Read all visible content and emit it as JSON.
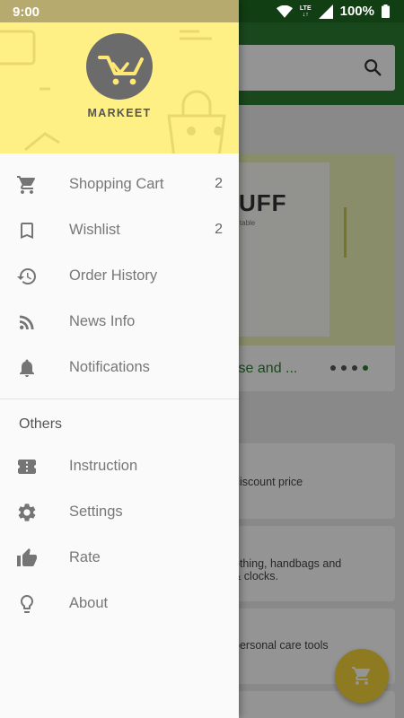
{
  "status_bar": {
    "time": "9:00",
    "network": "LTE",
    "battery": "100%"
  },
  "drawer": {
    "brand": "MARKEET",
    "menu": [
      {
        "label": "Shopping Cart",
        "badge": "2",
        "icon": "cart-icon"
      },
      {
        "label": "Wishlist",
        "badge": "2",
        "icon": "bookmark-icon"
      },
      {
        "label": "Order History",
        "badge": "",
        "icon": "history-icon"
      },
      {
        "label": "News Info",
        "badge": "",
        "icon": "rss-icon"
      },
      {
        "label": "Notifications",
        "badge": "",
        "icon": "bell-icon"
      }
    ],
    "section_title": "Others",
    "others": [
      {
        "label": "Instruction",
        "icon": "ticket-icon"
      },
      {
        "label": "Settings",
        "icon": "gear-icon"
      },
      {
        "label": "Rate",
        "icon": "thumb-up-icon"
      },
      {
        "label": "About",
        "icon": "lightbulb-icon"
      }
    ]
  },
  "background": {
    "banner_big_text": "UFF",
    "banner_small_text": "est table",
    "banner_caption": "wse and ...",
    "cards": [
      {
        "line1": "discount price",
        "line2": ""
      },
      {
        "line1": "othing, handbags and",
        "line2": "& clocks."
      },
      {
        "line1": "personal care tools",
        "line2": ""
      }
    ]
  },
  "colors": {
    "primary": "#2e7d32",
    "drawer_header": "#fff086",
    "logo_bg": "#6b6b6b",
    "fab": "#f5d33a"
  }
}
